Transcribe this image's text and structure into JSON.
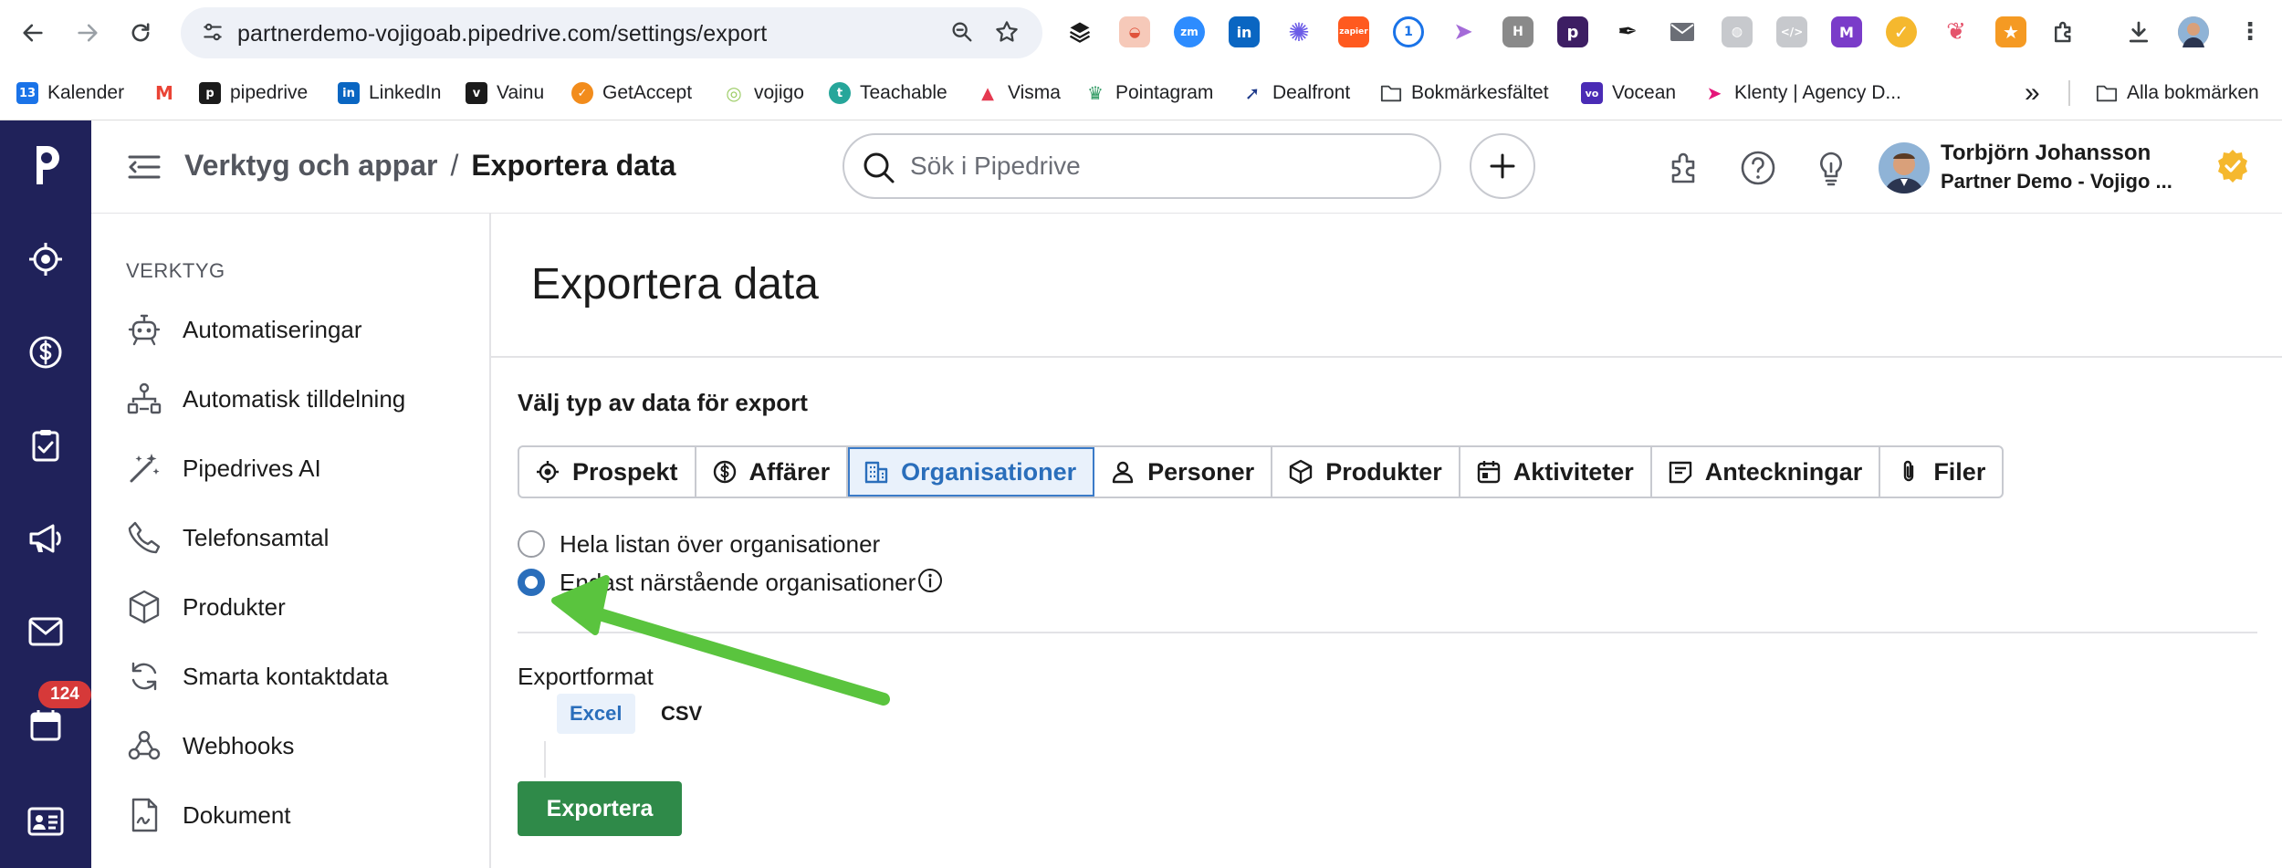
{
  "browser": {
    "url": "partnerdemo-vojigoab.pipedrive.com/settings/export",
    "bookmarks": [
      {
        "label": "Kalender",
        "fav": "13",
        "color": "#1a73e8"
      },
      {
        "label": "",
        "fav": "M",
        "color": "#ea4335"
      },
      {
        "label": "pipedrive",
        "fav": "p",
        "color": "#1b1b1b"
      },
      {
        "label": "LinkedIn",
        "fav": "in",
        "color": "#0a66c2"
      },
      {
        "label": "Vainu",
        "fav": "v",
        "color": "#1b1b1b"
      },
      {
        "label": "GetAccept",
        "fav": "✓",
        "color": "#f28c1c"
      },
      {
        "label": "vojigo",
        "fav": "◎",
        "color": "#9ccc65"
      },
      {
        "label": "Teachable",
        "fav": "t",
        "color": "#26a69a"
      },
      {
        "label": "Visma",
        "fav": "▲",
        "color": "#e53950"
      },
      {
        "label": "Pointagram",
        "fav": "♛",
        "color": "#2e9a62"
      },
      {
        "label": "Dealfront",
        "fav": "➚",
        "color": "#1e3a8a"
      },
      {
        "label": "Bokmärkesfältet",
        "fav": "",
        "color": "#ffffff"
      },
      {
        "label": "Vocean",
        "fav": "vo",
        "color": "#4a2bb5"
      },
      {
        "label": "Klenty | Agency D...",
        "fav": "➤",
        "color": "#e5167a"
      }
    ],
    "more_label": "»",
    "all_bookmarks": "Alla bokmärken"
  },
  "topbar": {
    "breadcrumb_parent": "Verktyg och appar",
    "breadcrumb_sep": "/",
    "breadcrumb_current": "Exportera data",
    "search_placeholder": "Sök i Pipedrive",
    "user_name": "Torbjörn Johansson",
    "user_company": "Partner Demo - Vojigo ..."
  },
  "leftnav": {
    "badge": "124"
  },
  "sidebar": {
    "title": "VERKTYG",
    "items": [
      {
        "label": "Automatiseringar",
        "icon": "robot-icon"
      },
      {
        "label": "Automatisk tilldelning",
        "icon": "assignment-icon"
      },
      {
        "label": "Pipedrives AI",
        "icon": "magic-wand-icon"
      },
      {
        "label": "Telefonsamtal",
        "icon": "phone-icon"
      },
      {
        "label": "Produkter",
        "icon": "box-icon"
      },
      {
        "label": "Smarta kontaktdata",
        "icon": "sync-icon"
      },
      {
        "label": "Webhooks",
        "icon": "webhook-icon"
      },
      {
        "label": "Dokument",
        "icon": "document-icon"
      }
    ]
  },
  "main": {
    "title": "Exportera data",
    "section_label": "Välj typ av data för export",
    "tabs": [
      {
        "label": "Prospekt",
        "icon": "target-icon"
      },
      {
        "label": "Affärer",
        "icon": "dollar-icon"
      },
      {
        "label": "Organisationer",
        "icon": "building-icon",
        "active": true
      },
      {
        "label": "Personer",
        "icon": "person-icon"
      },
      {
        "label": "Produkter",
        "icon": "box-icon"
      },
      {
        "label": "Aktiviteter",
        "icon": "calendar-icon"
      },
      {
        "label": "Anteckningar",
        "icon": "note-icon"
      },
      {
        "label": "Filer",
        "icon": "paperclip-icon"
      }
    ],
    "options": [
      {
        "label": "Hela listan över organisationer",
        "checked": false
      },
      {
        "label": "Endast närstående organisationer",
        "checked": true
      }
    ],
    "format_label": "Exportformat",
    "formats": [
      "Excel",
      "CSV"
    ],
    "selected_format": "Excel",
    "export_button": "Exportera"
  },
  "colors": {
    "nav_bg": "#20225a",
    "accent": "#2a6ebb",
    "export_green": "#2f8a49",
    "annotation_arrow": "#5ac43e",
    "badge_red": "#d63939"
  }
}
